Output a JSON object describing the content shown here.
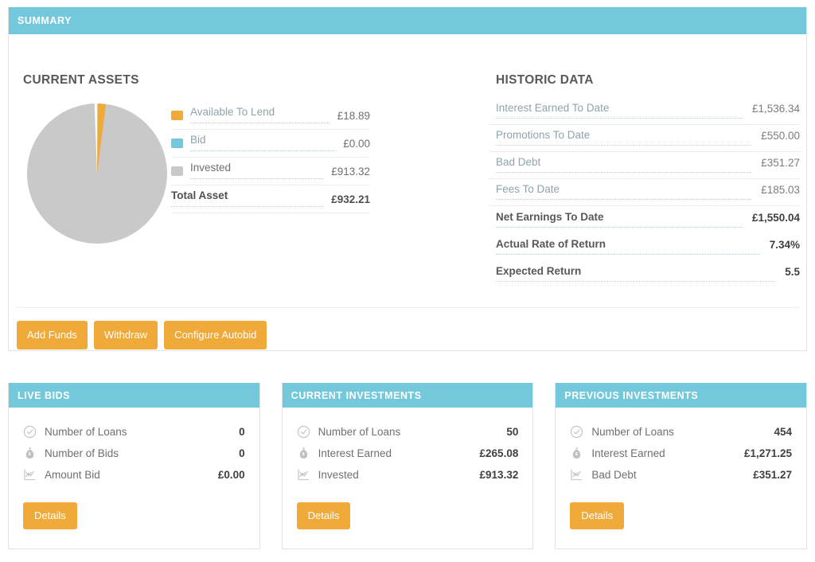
{
  "summary": {
    "header_title": "SUMMARY",
    "current_assets": {
      "title": "CURRENT ASSETS",
      "rows": [
        {
          "label": "Available To Lend",
          "value": "£18.89",
          "color": "#efaa3a",
          "swatch": "swatch-available-to-lend"
        },
        {
          "label": "Bid",
          "value": "£0.00",
          "color": "#73c8dc",
          "swatch": "swatch-bid"
        },
        {
          "label": "Invested",
          "value": "£913.32",
          "color": "#c9c9c9",
          "swatch": "swatch-invested"
        }
      ],
      "total": {
        "label": "Total Asset",
        "value": "£932.21"
      }
    },
    "historic_data": {
      "title": "HISTORIC DATA",
      "rows": [
        {
          "label": "Interest Earned To Date",
          "value": "£1,536.34"
        },
        {
          "label": "Promotions To Date",
          "value": "£550.00"
        },
        {
          "label": "Bad Debt",
          "value": "£351.27"
        },
        {
          "label": "Fees To Date",
          "value": "£185.03"
        },
        {
          "label": "Net Earnings To Date",
          "value": "£1,550.04"
        },
        {
          "label": "Actual Rate of Return",
          "value": "7.34%"
        },
        {
          "label": "Expected Return",
          "value": "5.5"
        }
      ]
    },
    "actions": [
      {
        "label": "Add Funds"
      },
      {
        "label": "Withdraw"
      },
      {
        "label": "Configure Autobid"
      }
    ]
  },
  "cards": [
    {
      "header_title": "LIVE BIDS",
      "rows": [
        {
          "icon": "check-circle-icon",
          "label": "Number of Loans",
          "value": "0"
        },
        {
          "icon": "money-bag-icon",
          "label": "Number of Bids",
          "value": "0"
        },
        {
          "icon": "line-chart-icon",
          "label": "Amount Bid",
          "value": "£0.00"
        }
      ],
      "button_label": "Details"
    },
    {
      "header_title": "CURRENT INVESTMENTS",
      "rows": [
        {
          "icon": "check-circle-icon",
          "label": "Number of Loans",
          "value": "50"
        },
        {
          "icon": "money-bag-icon",
          "label": "Interest Earned",
          "value": "£265.08"
        },
        {
          "icon": "line-chart-icon",
          "label": "Invested",
          "value": "£913.32"
        }
      ],
      "button_label": "Details"
    },
    {
      "header_title": "PREVIOUS INVESTMENTS",
      "rows": [
        {
          "icon": "check-circle-icon",
          "label": "Number of Loans",
          "value": "454"
        },
        {
          "icon": "money-bag-icon",
          "label": "Interest Earned",
          "value": "£1,271.25"
        },
        {
          "icon": "line-chart-icon",
          "label": "Bad Debt",
          "value": "£351.27"
        }
      ],
      "button_label": "Details"
    }
  ],
  "chart_data": {
    "type": "pie",
    "title": "CURRENT ASSETS",
    "labels": [
      "Available To Lend",
      "Bid",
      "Invested"
    ],
    "values": [
      18.89,
      0.0,
      913.32
    ],
    "colors": [
      "#efaa3a",
      "#73c8dc",
      "#c9c9c9"
    ],
    "total": 932.21,
    "percentages": [
      2.03,
      0.0,
      97.97
    ],
    "start_angle_deg": 0,
    "direction": "clockwise",
    "legend_position": "right",
    "grid": false
  },
  "theme": {
    "accent_teal": "#73c8dc",
    "accent_orange": "#efaa3a",
    "text_gray": "#6f6f71",
    "muted_teal_text": "#8fa3ad",
    "border": "#e2e2e2",
    "row_border": "#ededed"
  }
}
